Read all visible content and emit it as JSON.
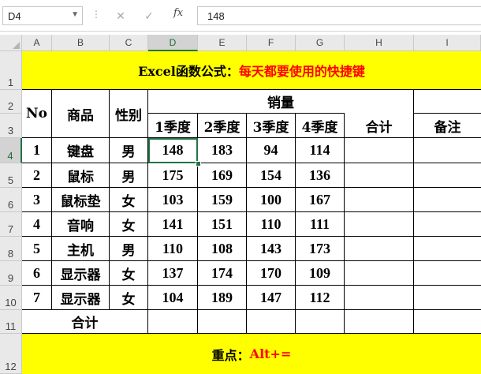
{
  "name_box": "D4",
  "toolbar": {
    "cancel_symbol": "✕",
    "enter_symbol": "✓",
    "fx_label": "fx"
  },
  "formula_bar": "148",
  "columns": [
    "A",
    "B",
    "C",
    "D",
    "E",
    "F",
    "G",
    "H",
    "I"
  ],
  "rows": [
    "1",
    "2",
    "3",
    "4",
    "5",
    "6",
    "7",
    "8",
    "9",
    "10",
    "11",
    "12"
  ],
  "title": {
    "prefix": "Excel函数公式：",
    "highlight": "每天都要使用的快捷键"
  },
  "headers": {
    "no": "No",
    "product": "商品",
    "gender": "性别",
    "sales": "销量",
    "q1": "1季度",
    "q2": "2季度",
    "q3": "3季度",
    "q4": "4季度",
    "total": "合计",
    "note": "备注"
  },
  "data_rows": [
    {
      "no": "1",
      "product": "键盘",
      "gender": "男",
      "q1": "148",
      "q2": "183",
      "q3": "94",
      "q4": "114"
    },
    {
      "no": "2",
      "product": "鼠标",
      "gender": "男",
      "q1": "175",
      "q2": "169",
      "q3": "154",
      "q4": "136"
    },
    {
      "no": "3",
      "product": "鼠标垫",
      "gender": "女",
      "q1": "103",
      "q2": "159",
      "q3": "100",
      "q4": "167"
    },
    {
      "no": "4",
      "product": "音响",
      "gender": "女",
      "q1": "141",
      "q2": "151",
      "q3": "110",
      "q4": "111"
    },
    {
      "no": "5",
      "product": "主机",
      "gender": "男",
      "q1": "110",
      "q2": "108",
      "q3": "143",
      "q4": "173"
    },
    {
      "no": "6",
      "product": "显示器",
      "gender": "女",
      "q1": "137",
      "q2": "174",
      "q3": "170",
      "q4": "109"
    },
    {
      "no": "7",
      "product": "显示器",
      "gender": "女",
      "q1": "104",
      "q2": "189",
      "q3": "147",
      "q4": "112"
    }
  ],
  "total_label": "合计",
  "footer": {
    "prefix": "重点：",
    "shortcut": "Alt+="
  },
  "colors": {
    "highlight_fill": "#ffff00",
    "highlight_text": "#ff0000",
    "selection": "#217346"
  }
}
